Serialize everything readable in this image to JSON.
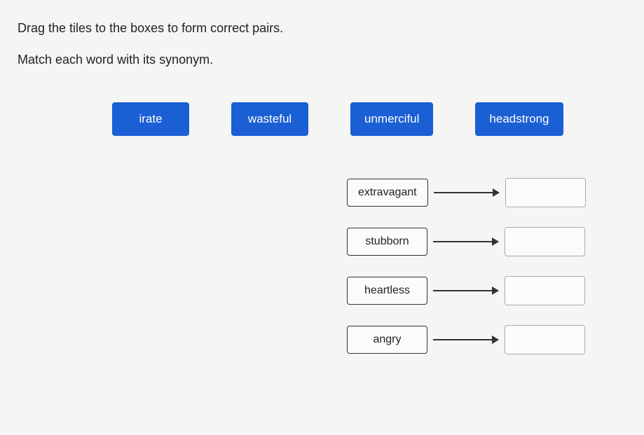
{
  "instructions": {
    "line1": "Drag the tiles to the boxes to form correct pairs.",
    "line2": "Match each word with its synonym."
  },
  "tiles": [
    {
      "label": "irate"
    },
    {
      "label": "wasteful"
    },
    {
      "label": "unmerciful"
    },
    {
      "label": "headstrong"
    }
  ],
  "pairs": [
    {
      "word": "extravagant",
      "answer": ""
    },
    {
      "word": "stubborn",
      "answer": ""
    },
    {
      "word": "heartless",
      "answer": ""
    },
    {
      "word": "angry",
      "answer": ""
    }
  ]
}
